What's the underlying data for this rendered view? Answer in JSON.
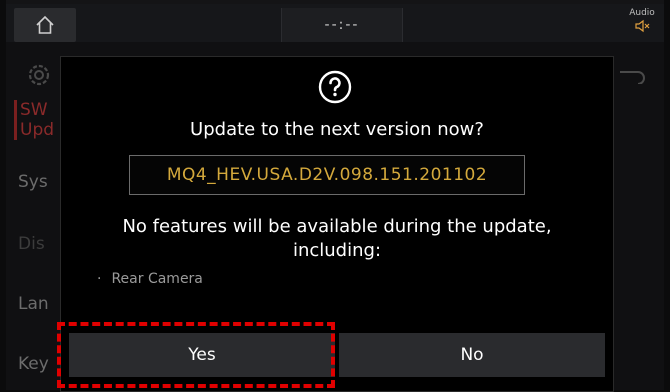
{
  "topbar": {
    "clock": "--:--",
    "audio_label": "Audio"
  },
  "background": {
    "items": [
      "SW\nUpd",
      "Sys",
      "Dis",
      "Lan",
      "Key"
    ]
  },
  "dialog": {
    "title": "Update to the next version now?",
    "version": "MQ4_HEV.USA.D2V.098.151.201102",
    "message": "No features will be available during the update, including:",
    "features": [
      "Rear Camera"
    ],
    "feature_bullet": "·",
    "yes_label": "Yes",
    "no_label": "No"
  },
  "colors": {
    "version_text": "#d4a93c",
    "highlight": "#e00000",
    "button_bg": "#2a2b2e"
  }
}
